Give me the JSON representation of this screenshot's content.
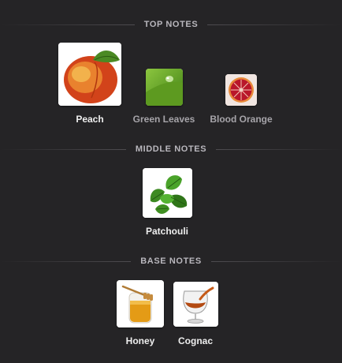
{
  "sections": {
    "top": {
      "title": "TOP NOTES",
      "notes": [
        {
          "name": "Peach",
          "icon": "peach-icon"
        },
        {
          "name": "Green Leaves",
          "icon": "green-leaves-icon"
        },
        {
          "name": "Blood Orange",
          "icon": "blood-orange-icon"
        }
      ]
    },
    "middle": {
      "title": "MIDDLE NOTES",
      "notes": [
        {
          "name": "Patchouli",
          "icon": "patchouli-icon"
        }
      ]
    },
    "base": {
      "title": "BASE NOTES",
      "notes": [
        {
          "name": "Honey",
          "icon": "honey-icon"
        },
        {
          "name": "Cognac",
          "icon": "cognac-icon"
        }
      ]
    }
  },
  "colors": {
    "background": "#252426",
    "header_text": "#b9b7bd",
    "label_primary": "#eeeeee",
    "label_secondary": "#a6a4a9"
  }
}
